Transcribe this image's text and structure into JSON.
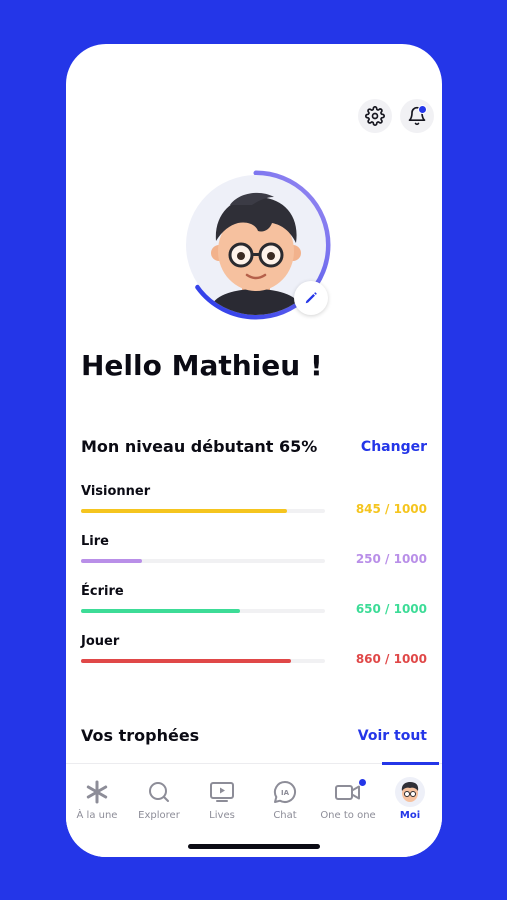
{
  "profile": {
    "greeting": "Hello Mathieu !",
    "progress": 0.65
  },
  "level": {
    "title": "Mon niveau débutant 65%",
    "change_label": "Changer"
  },
  "skills": [
    {
      "label": "Visionner",
      "value_text": "845 / 1000",
      "progress": 0.845,
      "color": "#f5c51f"
    },
    {
      "label": "Lire",
      "value_text": "250 / 1000",
      "progress": 0.25,
      "color": "#b98fe8"
    },
    {
      "label": "Écrire",
      "value_text": "650 / 1000",
      "progress": 0.65,
      "color": "#3ddc97"
    },
    {
      "label": "Jouer",
      "value_text": "860 / 1000",
      "progress": 0.86,
      "color": "#e04848"
    }
  ],
  "trophies": {
    "title": "Vos trophées",
    "see_all_label": "Voir tout"
  },
  "tabs": [
    {
      "label": "À la une",
      "icon": "asterisk-icon"
    },
    {
      "label": "Explorer",
      "icon": "search-icon"
    },
    {
      "label": "Lives",
      "icon": "tv-icon"
    },
    {
      "label": "Chat",
      "icon": "chat-ia-icon",
      "icon_text": "IA"
    },
    {
      "label": "One to one",
      "icon": "video-icon"
    },
    {
      "label": "Moi",
      "icon": "avatar-icon",
      "active": true
    }
  ],
  "colors": {
    "accent": "#2436e8",
    "background": "#2436e8"
  }
}
